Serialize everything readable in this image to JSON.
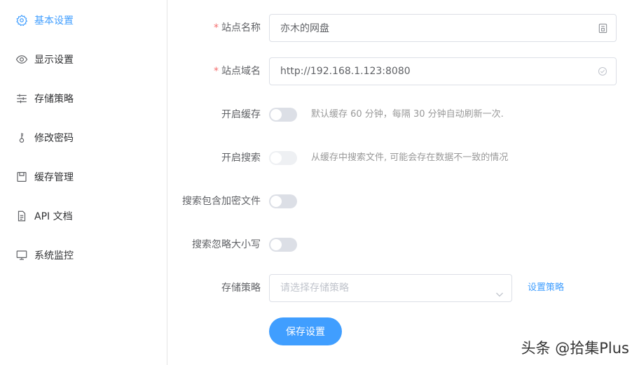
{
  "sidebar": {
    "items": [
      {
        "label": "基本设置",
        "icon": "gear-icon",
        "active": true
      },
      {
        "label": "显示设置",
        "icon": "eye-icon"
      },
      {
        "label": "存储策略",
        "icon": "sliders-icon"
      },
      {
        "label": "修改密码",
        "icon": "key-icon"
      },
      {
        "label": "缓存管理",
        "icon": "save-icon"
      },
      {
        "label": "API 文档",
        "icon": "document-icon"
      },
      {
        "label": "系统监控",
        "icon": "monitor-icon"
      }
    ]
  },
  "form": {
    "site_name": {
      "label": "站点名称",
      "required_mark": "*",
      "value": "亦木的网盘"
    },
    "site_domain": {
      "label": "站点域名",
      "required_mark": "*",
      "value": "http://192.168.1.123:8080"
    },
    "enable_cache": {
      "label": "开启缓存",
      "hint": "默认缓存 60 分钟，每隔 30 分钟自动刷新一次.",
      "on": false
    },
    "enable_search": {
      "label": "开启搜索",
      "hint": "从缓存中搜索文件, 可能会存在数据不一致的情况",
      "on": false,
      "disabled": true
    },
    "search_encrypted": {
      "label": "搜索包含加密文件",
      "on": false
    },
    "search_ignore_case": {
      "label": "搜索忽略大小写",
      "on": false
    },
    "storage_strategy": {
      "label": "存储策略",
      "placeholder": "请选择存储策略",
      "link": "设置策略"
    },
    "save_label": "保存设置"
  },
  "watermark": "头条 @拾集Plus",
  "colors": {
    "accent": "#409eff",
    "required": "#f56c6c",
    "switch_off": "#dcdfe6",
    "hint": "#999999"
  }
}
